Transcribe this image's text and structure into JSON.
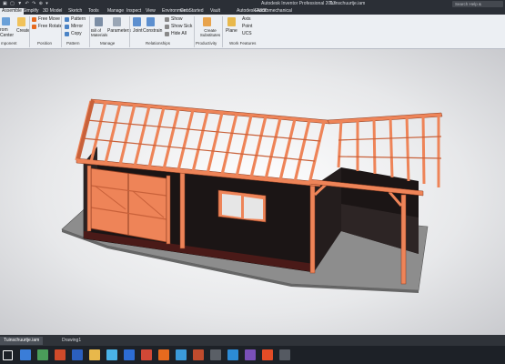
{
  "titlebar": {
    "app_title": "Autodesk Inventor Professional 2017",
    "doc_title": "Tuinschuurtje.iam",
    "search_placeholder": "Search Help & Commands",
    "qat": "▣ ▢ ▼ ↶ ↷ ⊕ ▾"
  },
  "tabs": [
    "Assemble",
    "Simplify",
    "3D Model",
    "Sketch",
    "Tools",
    "Manage",
    "Inspect",
    "View",
    "Environments",
    "Get Started",
    "Vault",
    "Autodesk A360",
    "Electromechanical"
  ],
  "ribbon": {
    "component": {
      "place_label": "Place",
      "label": "mponent",
      "create": "Create",
      "place2": "rom",
      "center": "Center"
    },
    "position": {
      "free_move": "Free Move",
      "free_rotate": "Free Rotate",
      "label": "Position"
    },
    "pattern": {
      "pattern": "Pattern",
      "mirror": "Mirror",
      "copy": "Copy",
      "label": "Pattern"
    },
    "manage": {
      "bom": "Bill of Materials",
      "parameters": "Parameters",
      "label": "Manage"
    },
    "relationships": {
      "joint": "Joint",
      "constrain": "Constrain",
      "show": "Show",
      "show_sick": "Show Sick",
      "hide_all": "Hide All",
      "label": "Relationships"
    },
    "productivity": {
      "create_substitutes": "Create Substitutes",
      "label": "Productivity"
    },
    "work_features": {
      "plane": "Plane",
      "axis": "Axis",
      "point": "Point",
      "ucs": "UCS",
      "label": "Work Features"
    }
  },
  "document_tabs": [
    "Tuinschuurtje.iam",
    "Drawing1"
  ],
  "colors": {
    "timber": "#ee8458",
    "timber_dark": "#c8613a",
    "wall": "#1b1515",
    "ground": "#8a8a8a",
    "titlebar": "#2b2f36",
    "accent": "#e66a1e"
  }
}
